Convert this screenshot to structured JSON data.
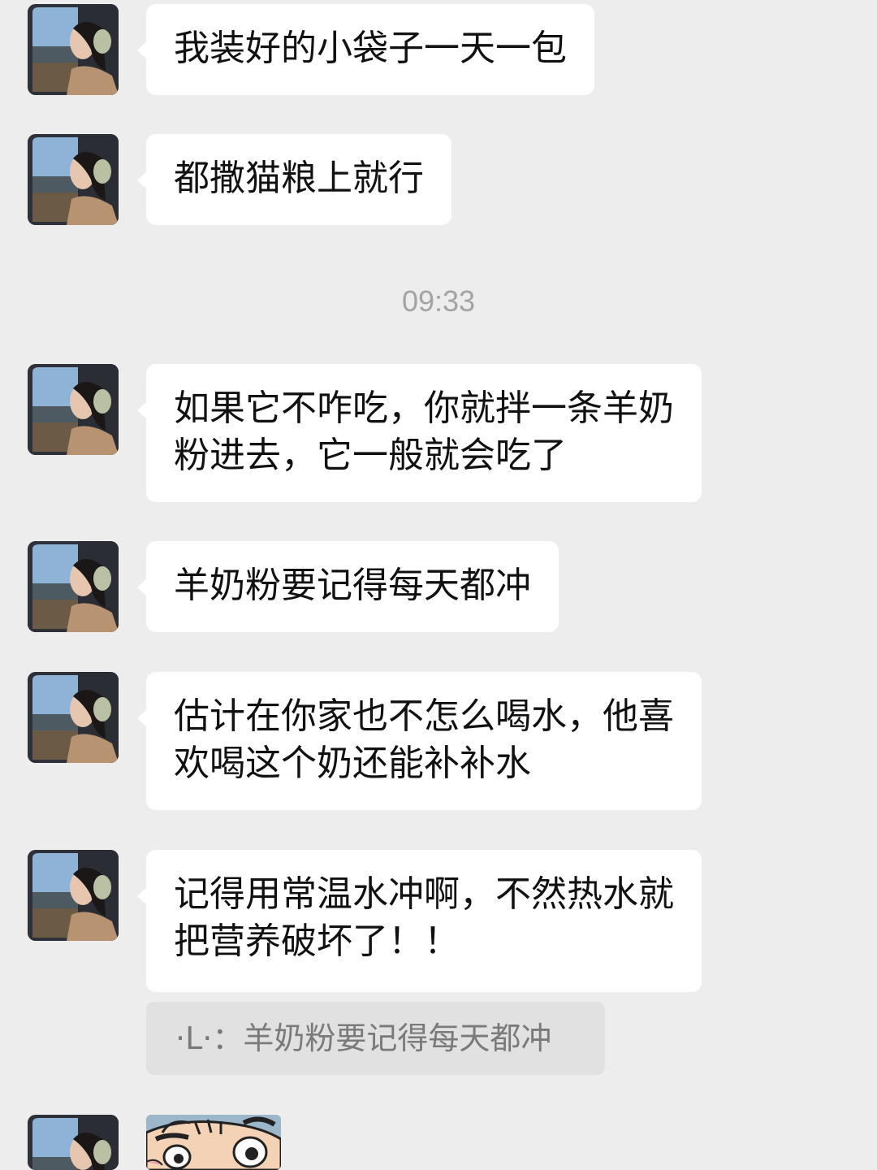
{
  "messages": [
    {
      "text": "我装好的小袋子一天一包"
    },
    {
      "text": "都撒猫粮上就行"
    },
    {
      "text": "如果它不咋吃，你就拌一条羊奶\n粉进去，它一般就会吃了"
    },
    {
      "text": "羊奶粉要记得每天都冲"
    },
    {
      "text": "估计在你家也不怎么喝水，他喜\n欢喝这个奶还能补补水"
    },
    {
      "text": "记得用常温水冲啊，不然热水就\n把营养破坏了！！"
    }
  ],
  "timestamp": "09:33",
  "quote": {
    "text": "·L·：羊奶粉要记得每天都冲"
  },
  "avatar_icon": "contact-avatar-icon",
  "sticker_icon": "cartoon-sticker-icon",
  "colors": {
    "background": "#ededed",
    "bubble": "#ffffff",
    "quote_bg": "#e1e1e1",
    "timestamp": "#a3a3a3"
  }
}
